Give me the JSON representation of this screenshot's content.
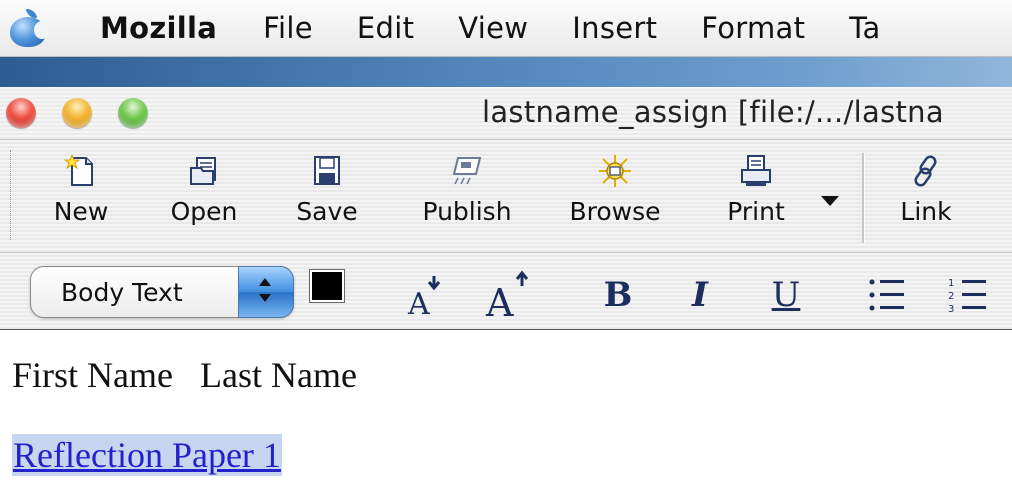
{
  "menubar": {
    "apple_icon": "apple-icon",
    "app_name": "Mozilla",
    "items": [
      "File",
      "Edit",
      "View",
      "Insert",
      "Format",
      "Ta"
    ]
  },
  "window": {
    "title": "lastname_assign [file:/.../lastna"
  },
  "toolbar": {
    "buttons": [
      {
        "label": "New",
        "icon": "new-document-icon"
      },
      {
        "label": "Open",
        "icon": "open-folder-icon"
      },
      {
        "label": "Save",
        "icon": "save-disk-icon"
      },
      {
        "label": "Publish",
        "icon": "publish-icon"
      },
      {
        "label": "Browse",
        "icon": "browse-icon"
      },
      {
        "label": "Print",
        "icon": "printer-icon"
      },
      {
        "label": "Link",
        "icon": "link-icon"
      }
    ]
  },
  "formatbar": {
    "paragraph_style": "Body Text",
    "text_color": "#000000",
    "background_color": "#ffffff",
    "bold_label": "B",
    "italic_label": "I",
    "underline_label": "U"
  },
  "document": {
    "line1": "First Name   Last Name",
    "link_text": "Reflection Paper 1",
    "link_color": "#2222cc"
  },
  "colors": {
    "desktop_blue": "#4d7fb5",
    "select_accent": "#3f8ee0"
  }
}
